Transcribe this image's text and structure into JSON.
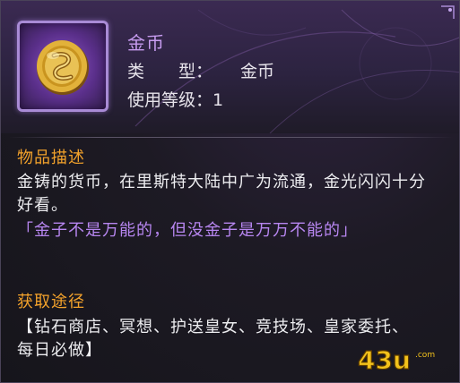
{
  "item": {
    "name": "金币",
    "type_label": "类　　型：",
    "type_value": "金币",
    "level_label": "使用等级：",
    "level_value": "1",
    "icon": "gold-coin-icon"
  },
  "description": {
    "title": "物品描述",
    "text": "金铸的货币，在里斯特大陆中广为流通，金光闪闪十分好看。",
    "quote": "「金子不是万能的，但没金子是万万不能的」"
  },
  "obtain": {
    "title": "获取途径",
    "text": "【钻石商店、冥想、护送皇女、竞技场、皇家委托、每日必做】"
  },
  "watermark": {
    "text": "43u",
    "suffix": ".com"
  },
  "colors": {
    "name": "#c79cf0",
    "section_title": "#f3a22b",
    "quote": "#b786f0",
    "body_text": "#ededf0",
    "frame": "#a98bd6",
    "coin": "#e2b23a"
  }
}
